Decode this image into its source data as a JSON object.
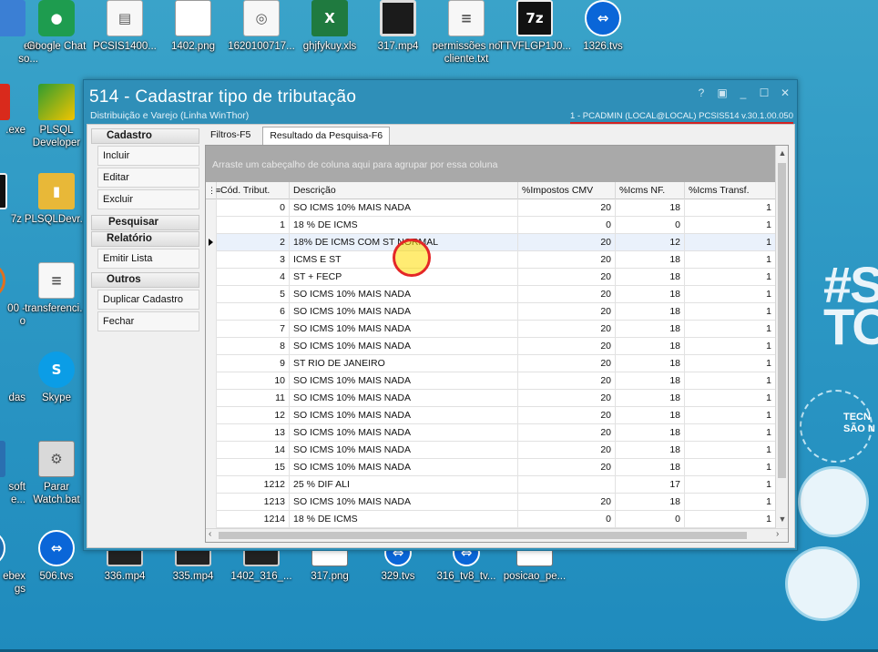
{
  "desktop": {
    "icons_top": [
      {
        "label": "ent\nso...",
        "icon": "app-icon"
      },
      {
        "label": "Google Chat",
        "icon": "chat-icon"
      },
      {
        "label": "PCSIS1400...",
        "icon": "doc-icon"
      },
      {
        "label": "1402.png",
        "icon": "image-icon"
      },
      {
        "label": "1620100717...",
        "icon": "web-icon"
      },
      {
        "label": "ghjfykuy.xls",
        "icon": "excel-icon"
      },
      {
        "label": "317.mp4",
        "icon": "video-icon"
      },
      {
        "label": "permissões no cliente.txt",
        "icon": "text-icon"
      },
      {
        "label": "TTVFLGP1J0...",
        "icon": "7zip-icon"
      },
      {
        "label": "1326.tvs",
        "icon": "teamviewer-icon"
      }
    ],
    "icons_left": [
      {
        "label": ".exe",
        "icon": "app-icon"
      },
      {
        "label": "PLSQL Developer",
        "icon": "plsql-icon"
      },
      {
        "label": "7z",
        "icon": "7zip-icon"
      },
      {
        "label": "PLSQLDevr...",
        "icon": "zip-icon"
      },
      {
        "label": "00 -\no",
        "icon": "app-icon"
      },
      {
        "label": "transferenci...",
        "icon": "text-icon"
      },
      {
        "label": "das",
        "icon": "app-icon"
      },
      {
        "label": "Skype",
        "icon": "skype-icon"
      },
      {
        "label": "soft\ne...",
        "icon": "app-icon"
      },
      {
        "label": "Parar Watch.bat",
        "icon": "bat-icon"
      }
    ],
    "icons_bottom": [
      {
        "label": "ebex\ngs",
        "icon": "app-icon"
      },
      {
        "label": "506.tvs",
        "icon": "teamviewer-icon"
      },
      {
        "label": "336.mp4",
        "icon": "video-icon"
      },
      {
        "label": "335.mp4",
        "icon": "video-icon"
      },
      {
        "label": "1402_316_...",
        "icon": "video-icon"
      },
      {
        "label": "317.png",
        "icon": "image-icon"
      },
      {
        "label": "329.tvs",
        "icon": "teamviewer-icon"
      },
      {
        "label": "316_tv8_tv...",
        "icon": "teamviewer-icon"
      },
      {
        "label": "posicao_pe...",
        "icon": "image-icon"
      }
    ],
    "wallpaper_text": {
      "hash": "#S\nTO",
      "tec": "TECN\nSÃO N"
    }
  },
  "window": {
    "title": "514 - Cadastrar tipo de tributação",
    "subtitle": "Distribuição e Varejo (Linha WinThor)",
    "info": "1 - PCADMIN (LOCAL@LOCAL)    PCSIS514  v.30.1.00.050",
    "controls": [
      "?",
      "▣",
      "_",
      "☐",
      "✕"
    ]
  },
  "sidebar": {
    "cadastro_header": "Cadastro",
    "cadastro_items": [
      "Incluir",
      "Editar",
      "Excluir"
    ],
    "pesquisar_header": "Pesquisar",
    "relatorio_header": "Relatório",
    "relatorio_items": [
      "Emitir Lista"
    ],
    "outros_header": "Outros",
    "outros_items": [
      "Duplicar Cadastro",
      "Fechar"
    ]
  },
  "tabs": [
    "Filtros-F5",
    "Resultado da Pesquisa-F6"
  ],
  "grid": {
    "group_hint": "Arraste um cabeçalho de coluna aqui para agrupar por essa coluna",
    "columns": [
      "Cód. Tribut.",
      "Descrição",
      "%Impostos CMV",
      "%Icms NF.",
      "%Icms Transf."
    ],
    "rows": [
      [
        "0",
        "SO ICMS 10% MAIS NADA",
        "20",
        "18",
        "1"
      ],
      [
        "1",
        "18 % DE ICMS",
        "0",
        "0",
        "1"
      ],
      [
        "2",
        "18% DE ICMS COM ST NORMAL",
        "20",
        "12",
        "1"
      ],
      [
        "3",
        "ICMS E ST",
        "20",
        "18",
        "1"
      ],
      [
        "4",
        "ST + FECP",
        "20",
        "18",
        "1"
      ],
      [
        "5",
        "SO ICMS 10% MAIS NADA",
        "20",
        "18",
        "1"
      ],
      [
        "6",
        "SO ICMS 10% MAIS NADA",
        "20",
        "18",
        "1"
      ],
      [
        "7",
        "SO ICMS 10% MAIS NADA",
        "20",
        "18",
        "1"
      ],
      [
        "8",
        "SO ICMS 10% MAIS NADA",
        "20",
        "18",
        "1"
      ],
      [
        "9",
        "ST RIO DE JANEIRO",
        "20",
        "18",
        "1"
      ],
      [
        "10",
        "SO ICMS 10% MAIS NADA",
        "20",
        "18",
        "1"
      ],
      [
        "11",
        "SO ICMS 10% MAIS NADA",
        "20",
        "18",
        "1"
      ],
      [
        "12",
        "SO ICMS 10% MAIS NADA",
        "20",
        "18",
        "1"
      ],
      [
        "13",
        "SO ICMS 10% MAIS NADA",
        "20",
        "18",
        "1"
      ],
      [
        "14",
        "SO ICMS 10% MAIS NADA",
        "20",
        "18",
        "1"
      ],
      [
        "15",
        "SO ICMS 10% MAIS NADA",
        "20",
        "18",
        "1"
      ],
      [
        "1212",
        "25 % DIF ALI",
        "",
        "17",
        "1"
      ],
      [
        "1213",
        "SO ICMS 10% MAIS NADA",
        "20",
        "18",
        "1"
      ],
      [
        "1214",
        "18 % DE ICMS",
        "0",
        "0",
        "1"
      ]
    ],
    "selected_row": 2
  },
  "colors": {
    "window_frame": "#2f8fb8",
    "group_bar": "#a9a9a9",
    "cursor_ring": "#e42727"
  }
}
